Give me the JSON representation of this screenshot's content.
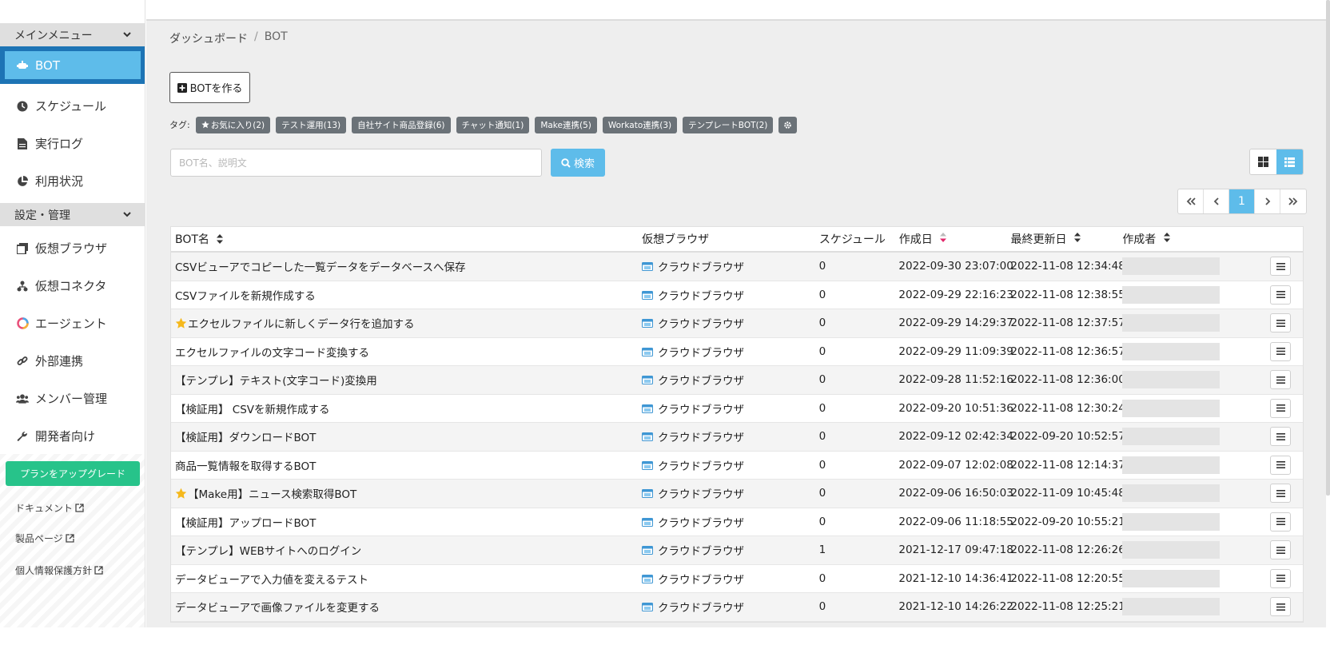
{
  "sidebar": {
    "main_menu_label": "メインメニュー",
    "main_items": [
      {
        "label": "BOT",
        "icon": "robot-icon",
        "active": true
      },
      {
        "label": "スケジュール",
        "icon": "clock-icon"
      },
      {
        "label": "実行ログ",
        "icon": "file-icon"
      },
      {
        "label": "利用状況",
        "icon": "pie-chart-icon"
      }
    ],
    "settings_label": "設定・管理",
    "settings_items": [
      {
        "label": "仮想ブラウザ",
        "icon": "browser-copy-icon"
      },
      {
        "label": "仮想コネクタ",
        "icon": "connector-icon"
      },
      {
        "label": "エージェント",
        "icon": "agent-icon"
      },
      {
        "label": "外部連携",
        "icon": "link-icon"
      },
      {
        "label": "メンバー管理",
        "icon": "users-icon"
      },
      {
        "label": "開発者向け",
        "icon": "wrench-icon"
      }
    ],
    "upgrade_label": "プランをアップグレード",
    "links": [
      {
        "label": "ドキュメント"
      },
      {
        "label": "製品ページ"
      },
      {
        "label": "個人情報保護方針"
      }
    ]
  },
  "breadcrumb": {
    "root": "ダッシュボード",
    "separator": "/",
    "current": "BOT"
  },
  "create_button": {
    "label": "BOTを作る"
  },
  "tags": {
    "label": "タグ:",
    "items": [
      "お気に入り(2)",
      "テスト運用(13)",
      "自社サイト商品登録(6)",
      "チャット通知(1)",
      "Make連携(5)",
      "Workato連携(3)",
      "テンプレートBOT(2)"
    ]
  },
  "search": {
    "placeholder": "BOT名、説明文",
    "button_label": "検索"
  },
  "pagination": {
    "current": "1"
  },
  "table": {
    "headers": {
      "name": "BOT名",
      "browser": "仮想ブラウザ",
      "schedule": "スケジュール",
      "created": "作成日",
      "updated": "最終更新日",
      "author": "作成者"
    },
    "rows": [
      {
        "name": "CSVビューアでコピーした一覧データをデータベースへ保存",
        "browser": "クラウドブラウザ",
        "schedule": "0",
        "created": "2022-09-30 23:07:00",
        "updated": "2022-11-08 12:34:48"
      },
      {
        "name": "CSVファイルを新規作成する",
        "browser": "クラウドブラウザ",
        "schedule": "0",
        "created": "2022-09-29 22:16:23",
        "updated": "2022-11-08 12:38:55"
      },
      {
        "name": "エクセルファイルに新しくデータ行を追加する",
        "browser": "クラウドブラウザ",
        "schedule": "0",
        "created": "2022-09-29 14:29:37",
        "updated": "2022-11-08 12:37:57",
        "favorite": true
      },
      {
        "name": "エクセルファイルの文字コード変換する",
        "browser": "クラウドブラウザ",
        "schedule": "0",
        "created": "2022-09-29 11:09:39",
        "updated": "2022-11-08 12:36:57"
      },
      {
        "name": "【テンプレ】テキスト(文字コード)変換用",
        "browser": "クラウドブラウザ",
        "schedule": "0",
        "created": "2022-09-28 11:52:16",
        "updated": "2022-11-08 12:36:00"
      },
      {
        "name": "【検証用】 CSVを新規作成する",
        "browser": "クラウドブラウザ",
        "schedule": "0",
        "created": "2022-09-20 10:51:36",
        "updated": "2022-11-08 12:30:24"
      },
      {
        "name": "【検証用】ダウンロードBOT",
        "browser": "クラウドブラウザ",
        "schedule": "0",
        "created": "2022-09-12 02:42:34",
        "updated": "2022-09-20 10:52:57"
      },
      {
        "name": "商品一覧情報を取得するBOT",
        "browser": "クラウドブラウザ",
        "schedule": "0",
        "created": "2022-09-07 12:02:08",
        "updated": "2022-11-08 12:14:37"
      },
      {
        "name": "【Make用】ニュース検索取得BOT",
        "browser": "クラウドブラウザ",
        "schedule": "0",
        "created": "2022-09-06 16:50:03",
        "updated": "2022-11-09 10:45:48",
        "favorite": true
      },
      {
        "name": "【検証用】アップロードBOT",
        "browser": "クラウドブラウザ",
        "schedule": "0",
        "created": "2022-09-06 11:18:55",
        "updated": "2022-09-20 10:55:21"
      },
      {
        "name": "【テンプレ】WEBサイトへのログイン",
        "browser": "クラウドブラウザ",
        "schedule": "1",
        "created": "2021-12-17 09:47:18",
        "updated": "2022-11-08 12:26:26"
      },
      {
        "name": "データビューアで入力値を変えるテスト",
        "browser": "クラウドブラウザ",
        "schedule": "0",
        "created": "2021-12-10 14:36:41",
        "updated": "2022-11-08 12:20:55"
      },
      {
        "name": "データビューアで画像ファイルを変更する",
        "browser": "クラウドブラウザ",
        "schedule": "0",
        "created": "2021-12-10 14:26:22",
        "updated": "2022-11-08 12:25:21"
      }
    ]
  },
  "colors": {
    "accent": "#5ebcea",
    "active_border": "#1d74b5",
    "upgrade": "#27c38a",
    "tag_bg": "#6b7278",
    "sort_active": "#e2286b"
  }
}
